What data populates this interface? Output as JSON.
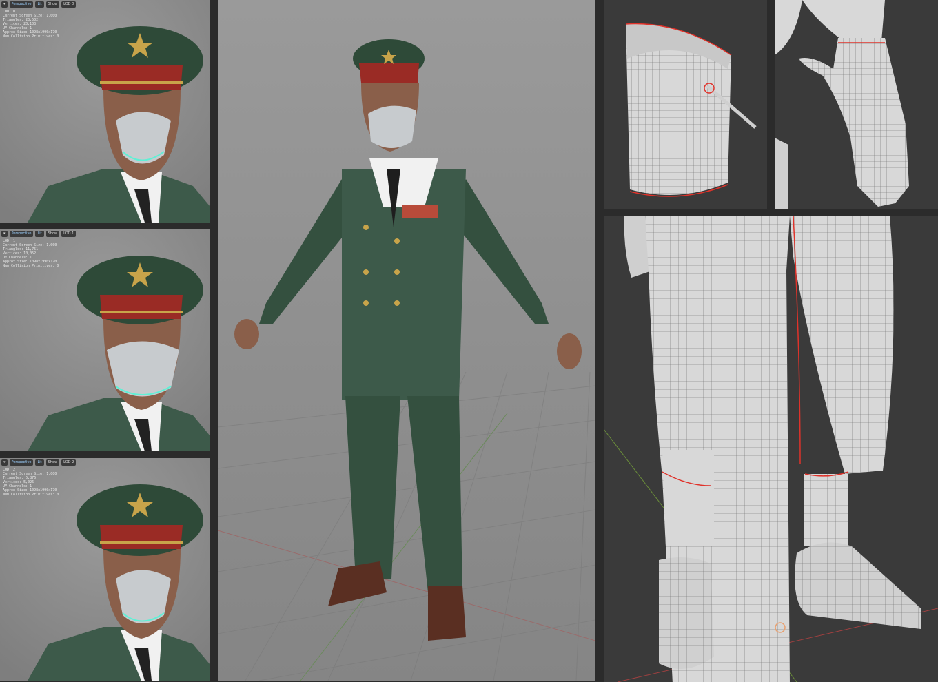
{
  "lod_viewports": [
    {
      "toolbar": {
        "menu_icon": "dropdown-icon",
        "view": "Perspective",
        "lit": "Lit",
        "show": "Show",
        "lod": "LOD 0"
      },
      "stats": [
        "LOD: 0",
        "Current Screen Size: 1.000",
        "Triangles: 23,502",
        "Vertices: 20,103",
        "UV Channels: 1",
        "Approx Size: 1098x1990x170",
        "",
        "Num Collision Primitives: 0"
      ]
    },
    {
      "toolbar": {
        "menu_icon": "dropdown-icon",
        "view": "Perspective",
        "lit": "Lit",
        "show": "Show",
        "lod": "LOD 1"
      },
      "stats": [
        "LOD: 1",
        "Current Screen Size: 1.000",
        "Triangles: 11,751",
        "Vertices: 10,052",
        "UV Channels: 1",
        "Approx Size: 1098x1990x170",
        "",
        "Num Collision Primitives: 0"
      ]
    },
    {
      "toolbar": {
        "menu_icon": "dropdown-icon",
        "view": "Perspective",
        "lit": "Lit",
        "show": "Show",
        "lod": "LOD 2"
      },
      "stats": [
        "LOD: 2",
        "Current Screen Size: 1.000",
        "Triangles: 5,876",
        "Vertices: 5,026",
        "UV Channels: 1",
        "Approx Size: 1098x1990x170",
        "",
        "Num Collision Primitives: 0"
      ]
    }
  ],
  "colors": {
    "uniform_green": "#3d5a4a",
    "cap_band": "#9a2b25",
    "gold": "#c8a44a",
    "skin": "#8a5f4a",
    "mask": "#c7cbce",
    "mesh_grey": "#d8d8d8",
    "seam_red": "#e0322a",
    "viewport_bg": "#3a3a3a",
    "preview_bg": "#8d8d8d"
  }
}
